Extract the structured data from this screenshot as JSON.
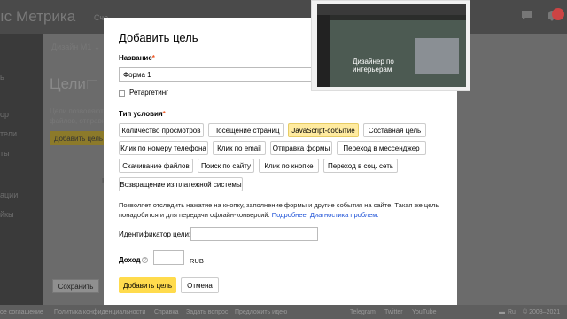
{
  "header": {
    "logo_text": "ıс Метрика",
    "nav_fragment": "Сче"
  },
  "sidebar": {
    "items": [
      "ь",
      "ор",
      "тели",
      "ты",
      "ации",
      "йкы"
    ]
  },
  "background": {
    "design_tab": "Дизайн М1",
    "page_title": "Цели",
    "desc_line1": "Цели позволяют от",
    "desc_line2": "файлов, отправку с",
    "add_goal_label": "Добавить цель",
    "na_label": "На",
    "save_label": "Сохранить"
  },
  "modal": {
    "title": "Добавить цель",
    "name_label": "Название",
    "required_mark": "*",
    "name_value": "Форма 1",
    "retargeting_label": "Ретаргетинг",
    "condition_type_label": "Тип условия",
    "conditions": [
      "Количество просмотров",
      "Посещение страниц",
      "JavaScript-событие",
      "Составная цель",
      "Клик по номеру телефона",
      "Клик по email",
      "Отправка формы",
      "Переход в мессенджер",
      "Скачивание файлов",
      "Поиск по сайту",
      "Клик по кнопке",
      "Переход в соц. сеть",
      "Возвращение из платежной системы"
    ],
    "selected_condition": "JavaScript-событие",
    "description": "Позволяет отследить нажатие на кнопку, заполнение формы и другие события на сайте. Такая же цель понадобится и для передачи офлайн-конверсий. ",
    "link_more": "Подробнее.",
    "link_diag": "Диагностика проблем.",
    "id_label": "Идентификатор цели:",
    "id_value": "",
    "income_label": "Доход",
    "help_icon_glyph": "?",
    "income_value": "",
    "currency": "RUB",
    "add_button": "Добавить цель",
    "cancel_button": "Отмена"
  },
  "video_overlay": {
    "hero_text": "Дизайнер по интерьерам"
  },
  "footer": {
    "links": [
      "ое соглашение",
      "Политика конфиденциальности",
      "Справка",
      "Задать вопрос",
      "Предложить идею"
    ],
    "social": [
      "Telegram",
      "Twitter",
      "YouTube"
    ],
    "lang": "Ru",
    "copyright": "© 2008–2021"
  },
  "colors": {
    "accent": "#ffdb4d",
    "selected_chip": "#ffeba0",
    "link": "#1a4fd6"
  }
}
